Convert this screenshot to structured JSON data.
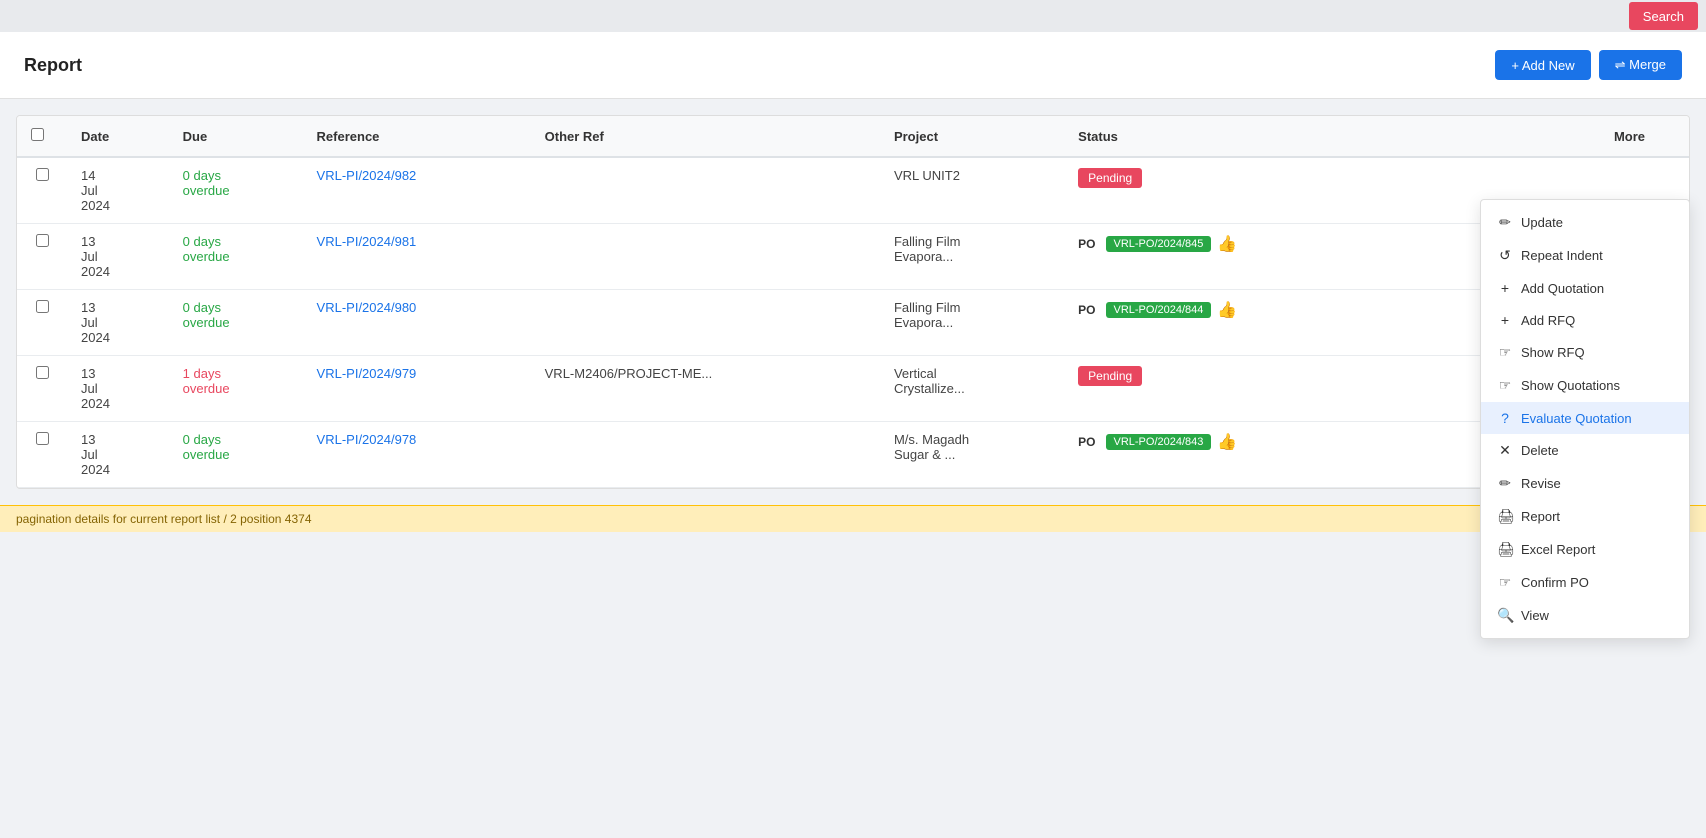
{
  "topbar": {
    "search_label": "Search"
  },
  "header": {
    "title": "Report",
    "add_new_label": "+ Add New",
    "merge_label": "⇌ Merge"
  },
  "table": {
    "columns": [
      "",
      "Date",
      "Due",
      "Reference",
      "Other Ref",
      "Project",
      "Status",
      "",
      "More",
      ""
    ],
    "rows": [
      {
        "date": "14\nJul\n2024",
        "due": "0 days\noverdue",
        "due_class": "overdue-0",
        "reference": "VRL-PI/2024/982",
        "other_ref": "",
        "project": "VRL UNIT2",
        "status_type": "pending",
        "status_label": "Pending",
        "po_ref": "",
        "po_badge": ""
      },
      {
        "date": "13\nJul\n2024",
        "due": "0 days\noverdue",
        "due_class": "overdue-0",
        "reference": "VRL-PI/2024/981",
        "other_ref": "",
        "project": "Falling Film\nEvapora...",
        "status_type": "po",
        "status_label": "PO",
        "po_badge": "VRL-PO/2024/845"
      },
      {
        "date": "13\nJul\n2024",
        "due": "0 days\noverdue",
        "due_class": "overdue-0",
        "reference": "VRL-PI/2024/980",
        "other_ref": "",
        "project": "Falling Film\nEvapora...",
        "status_type": "po",
        "status_label": "PO",
        "po_badge": "VRL-PO/2024/844"
      },
      {
        "date": "13\nJul\n2024",
        "due": "1 days\noverdue",
        "due_class": "overdue-1",
        "reference": "VRL-PI/2024/979",
        "other_ref": "VRL-M2406/PROJECT-ME...",
        "project": "Vertical\nCrystallize...",
        "status_type": "pending",
        "status_label": "Pending",
        "po_badge": ""
      },
      {
        "date": "13\nJul\n2024",
        "due": "0 days\noverdue",
        "due_class": "overdue-0",
        "reference": "VRL-PI/2024/978",
        "other_ref": "",
        "project": "M/s. Magadh\nSugar & ...",
        "status_type": "po",
        "status_label": "PO",
        "po_badge": "VRL-PO/2024/843"
      }
    ]
  },
  "context_menu": {
    "items": [
      {
        "icon": "✏",
        "label": "Update"
      },
      {
        "icon": "↺",
        "label": "Repeat Indent"
      },
      {
        "icon": "+",
        "label": "Add Quotation"
      },
      {
        "icon": "+",
        "label": "Add RFQ"
      },
      {
        "icon": "☞",
        "label": "Show RFQ"
      },
      {
        "icon": "☞",
        "label": "Show Quotations"
      },
      {
        "icon": "?",
        "label": "Evaluate Quotation",
        "active": true
      },
      {
        "icon": "✕",
        "label": "Delete"
      },
      {
        "icon": "✏",
        "label": "Revise"
      },
      {
        "icon": "🖨",
        "label": "Report"
      },
      {
        "icon": "🖨",
        "label": "Excel Report"
      },
      {
        "icon": "☞",
        "label": "Confirm PO"
      },
      {
        "icon": "🔍",
        "label": "View"
      }
    ]
  },
  "bottom_bar": {
    "text": "pagination details for current report list / 2 position 4374"
  }
}
